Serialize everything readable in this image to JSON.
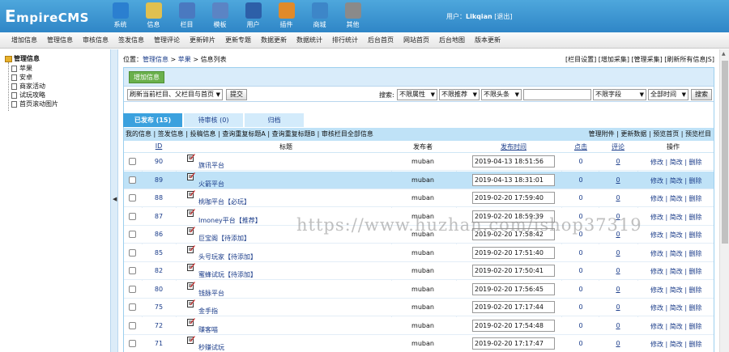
{
  "app": {
    "logo": "EmpireCMS",
    "logo_first": "E",
    "logo_rest": "mpireCMS"
  },
  "nav_icons": [
    {
      "label": "系统",
      "icon": "globe-icon",
      "color": "#2b7fd0"
    },
    {
      "label": "信息",
      "icon": "notepad-icon",
      "color": "#e0c050"
    },
    {
      "label": "栏目",
      "icon": "folder-icon",
      "color": "#4a79c0"
    },
    {
      "label": "模板",
      "icon": "template-icon",
      "color": "#5b84c4"
    },
    {
      "label": "用户",
      "icon": "user-icon",
      "color": "#2d5fa8"
    },
    {
      "label": "插件",
      "icon": "tools-icon",
      "color": "#e08a2a"
    },
    {
      "label": "商城",
      "icon": "shop-icon",
      "color": "#3d86c8"
    },
    {
      "label": "其他",
      "icon": "gear-icon",
      "color": "#8a8a8a"
    }
  ],
  "user": {
    "prefix": "用户：",
    "name": "Likqian",
    "logout": "[退出]"
  },
  "menu": [
    "增加信息",
    "管理信息",
    "审核信息",
    "签发信息",
    "管理评论",
    "更新碎片",
    "更新专题",
    "数据更新",
    "数据统计",
    "排行统计",
    "后台首页",
    "网站首页",
    "后台地图",
    "版本更新"
  ],
  "sidebar": {
    "root": "管理信息",
    "items": [
      "苹果",
      "安卓",
      "商家活动",
      "试玩攻略",
      "首页滚动图片"
    ]
  },
  "breadcrumb": {
    "prefix": "位置：",
    "a": "管理信息",
    "sep1": " > ",
    "b": "苹果",
    "sep2": " > ",
    "c": "信息列表"
  },
  "toplinks": "[栏目设置] [增加采集] [管理采集] [刷新所有信息JS]",
  "add_button": "增加信息",
  "controls": {
    "refresh_select": "刷新当前栏目、父栏目与首页",
    "submit": "提交",
    "search_label": "搜索:",
    "attr_select": "不限属性",
    "recommend_select": "不限推荐",
    "headline_select": "不限头条",
    "search_value": "",
    "field_select": "不限字段",
    "time_select": "全部时间",
    "search_button": "搜索"
  },
  "tabs": [
    {
      "label": "已发布 (15)",
      "active": true
    },
    {
      "label": "待审核 (0)",
      "active": false
    },
    {
      "label": "归档",
      "active": false
    }
  ],
  "subbar_left": "我的信息 | 签发信息 | 投稿信息 | 查询重复标题A | 查询重复标题B | 审核栏目全部信息",
  "subbar_right": "管理附件 | 更新数据 | 预览首页 | 预览栏目",
  "columns": {
    "id": "ID",
    "title": "标题",
    "publisher": "发布者",
    "time": "发布时间",
    "clicks": "点击",
    "comments": "评论",
    "ops": "操作"
  },
  "ops_text": "修改 | 简改 | 删除",
  "rows": [
    {
      "id": "90",
      "title": "旗讯平台",
      "publisher": "muban",
      "time": "2019-04-13 18:51:56",
      "clicks": "0",
      "comments": "0"
    },
    {
      "id": "89",
      "title": "火箭平台",
      "publisher": "muban",
      "time": "2019-04-13 18:31:01",
      "clicks": "0",
      "comments": "0",
      "highlight": true
    },
    {
      "id": "88",
      "title": "桃咖平台【必玩】",
      "publisher": "muban",
      "time": "2019-02-20 17:59:40",
      "clicks": "0",
      "comments": "0"
    },
    {
      "id": "87",
      "title": "Imoney平台【推荐】",
      "publisher": "muban",
      "time": "2019-02-20 18:59:39",
      "clicks": "0",
      "comments": "0"
    },
    {
      "id": "86",
      "title": "巨宝阁【待添加】",
      "publisher": "muban",
      "time": "2019-02-20 17:58:42",
      "clicks": "0",
      "comments": "0"
    },
    {
      "id": "85",
      "title": "头号玩家【待添加】",
      "publisher": "muban",
      "time": "2019-02-20 17:51:40",
      "clicks": "0",
      "comments": "0"
    },
    {
      "id": "82",
      "title": "蜜蜂试玩【待添加】",
      "publisher": "muban",
      "time": "2019-02-20 17:50:41",
      "clicks": "0",
      "comments": "0"
    },
    {
      "id": "80",
      "title": "钱脉平台",
      "publisher": "muban",
      "time": "2019-02-20 17:56:45",
      "clicks": "0",
      "comments": "0"
    },
    {
      "id": "75",
      "title": "金手指",
      "publisher": "muban",
      "time": "2019-02-20 17:17:44",
      "clicks": "0",
      "comments": "0"
    },
    {
      "id": "72",
      "title": "赚客喵",
      "publisher": "muban",
      "time": "2019-02-20 17:54:48",
      "clicks": "0",
      "comments": "0"
    },
    {
      "id": "71",
      "title": "秒赚试玩",
      "publisher": "muban",
      "time": "2019-02-20 17:17:47",
      "clicks": "0",
      "comments": "0"
    }
  ],
  "watermark": "https://www.huzhan.com/ishop37319"
}
